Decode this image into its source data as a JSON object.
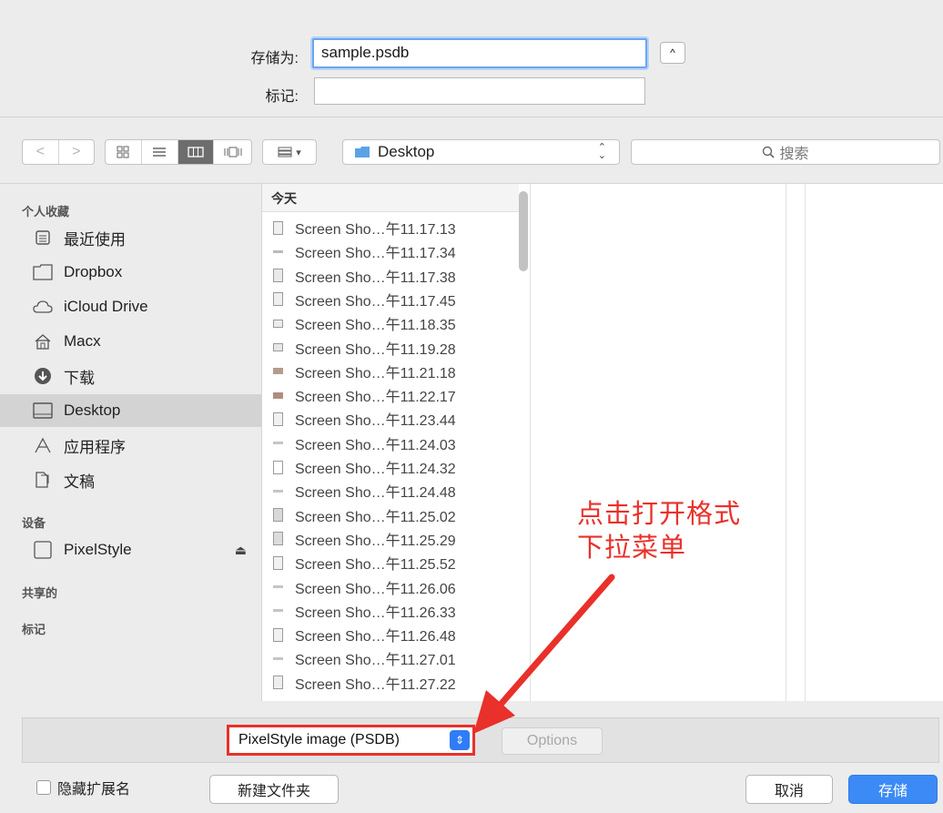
{
  "save_as": {
    "name_label": "存储为:",
    "name_value": "sample.psdb",
    "tags_label": "标记:",
    "tags_value": "",
    "collapse_glyph": "^"
  },
  "toolbar": {
    "back_glyph": "<",
    "forward_glyph": ">",
    "view_modes": [
      "icon",
      "list",
      "column",
      "cover-flow"
    ],
    "active_view": "column",
    "arrange_glyph": "▾",
    "location": "Desktop",
    "location_chevron": "⌃⌄",
    "search_placeholder": "搜索"
  },
  "sidebar": {
    "favorites_heading": "个人收藏",
    "favorites": [
      {
        "label": "最近使用",
        "icon": "recents-icon"
      },
      {
        "label": "Dropbox",
        "icon": "folder-icon"
      },
      {
        "label": "iCloud Drive",
        "icon": "cloud-icon"
      },
      {
        "label": "Macx",
        "icon": "home-icon"
      },
      {
        "label": "下载",
        "icon": "download-icon"
      },
      {
        "label": "Desktop",
        "icon": "desktop-icon",
        "selected": true
      },
      {
        "label": "应用程序",
        "icon": "applications-icon"
      },
      {
        "label": "文稿",
        "icon": "documents-icon"
      }
    ],
    "devices_heading": "设备",
    "devices": [
      {
        "label": "PixelStyle",
        "icon": "disk-icon",
        "eject": "⏏"
      }
    ],
    "shared_heading": "共享的",
    "tags_heading": "标记"
  },
  "file_list": {
    "group_heading": "今天",
    "files": [
      "Screen Sho…午11.17.13",
      "Screen Sho…午11.17.34",
      "Screen Sho…午11.17.38",
      "Screen Sho…午11.17.45",
      "Screen Sho…午11.18.35",
      "Screen Sho…午11.19.28",
      "Screen Sho…午11.21.18",
      "Screen Sho…午11.22.17",
      "Screen Sho…午11.23.44",
      "Screen Sho…午11.24.03",
      "Screen Sho…午11.24.32",
      "Screen Sho…午11.24.48",
      "Screen Sho…午11.25.02",
      "Screen Sho…午11.25.29",
      "Screen Sho…午11.25.52",
      "Screen Sho…午11.26.06",
      "Screen Sho…午11.26.33",
      "Screen Sho…午11.26.48",
      "Screen Sho…午11.27.01",
      "Screen Sho…午11.27.22"
    ]
  },
  "format": {
    "selected": "PixelStyle image (PSDB)",
    "options_label": "Options"
  },
  "bottom": {
    "hide_extension_label": "隐藏扩展名",
    "new_folder_label": "新建文件夹",
    "cancel_label": "取消",
    "save_label": "存储"
  },
  "annotation": {
    "line1": "点击打开格式",
    "line2": "下拉菜单",
    "color": "#e9302a"
  },
  "colors": {
    "accent": "#3b8af5",
    "annotation_red": "#e9302a",
    "sidebar_selected": "#d3d3d3"
  }
}
